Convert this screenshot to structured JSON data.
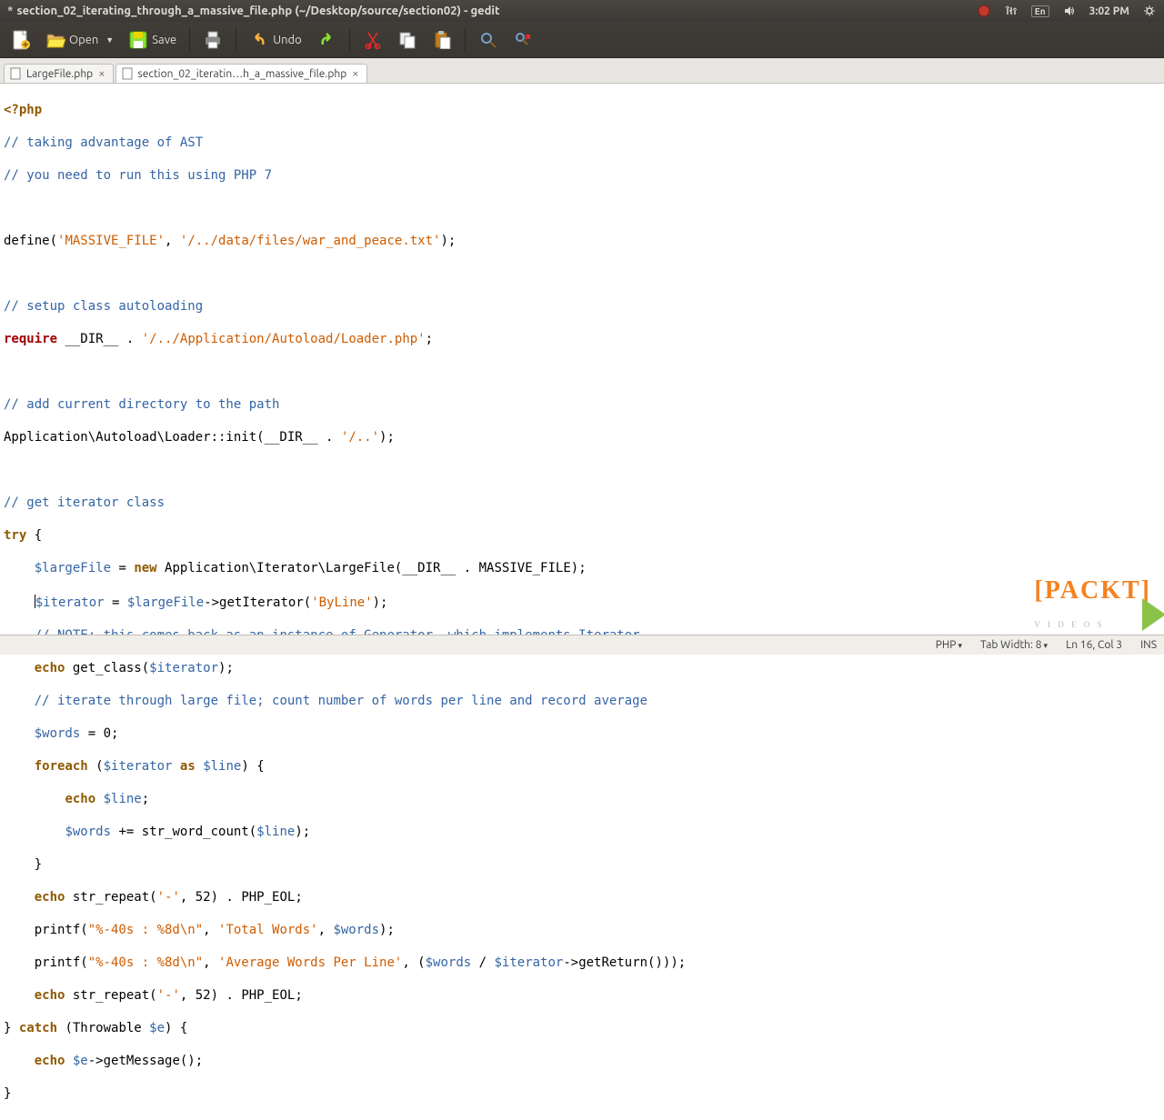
{
  "titlebar": {
    "prefix": "*",
    "title": "section_02_iterating_through_a_massive_file.php (~/Desktop/source/section02) - gedit",
    "tray": {
      "lang": "En",
      "time": "3:02 PM"
    }
  },
  "toolbar": {
    "open": "Open",
    "save": "Save",
    "undo": "Undo"
  },
  "tabs": [
    {
      "label": "LargeFile.php"
    },
    {
      "label": "section_02_iteratin…h_a_massive_file.php"
    }
  ],
  "code": {
    "l01_open": "<?php",
    "l02": "// taking advantage of AST",
    "l03": "// you need to run this using PHP 7",
    "l05a": "define(",
    "l05b": "'MASSIVE_FILE'",
    "l05c": ", ",
    "l05d": "'/../data/files/war_and_peace.txt'",
    "l05e": ");",
    "l07": "// setup class autoloading",
    "l08a": "require ",
    "l08b": "__DIR__",
    "l08c": " . ",
    "l08d": "'/../Application/Autoload/Loader.php'",
    "l08e": ";",
    "l10": "// add current directory to the path",
    "l11a": "Application\\Autoload\\Loader::init(",
    "l11b": "__DIR__",
    "l11c": " . ",
    "l11d": "'/..'",
    "l11e": ");",
    "l13": "// get iterator class",
    "l14a": "try",
    "l14b": " {",
    "l15a": "    ",
    "l15b": "$largeFile",
    "l15c": " = ",
    "l15d": "new",
    "l15e": " Application\\Iterator\\LargeFile(",
    "l15f": "__DIR__",
    "l15g": " . MASSIVE_FILE);",
    "l16a": "    ",
    "l16b": "$iterator",
    "l16c": " = ",
    "l16d": "$largeFile",
    "l16e": "->getIterator(",
    "l16f": "'ByLine'",
    "l16g": ");",
    "l17a": "    ",
    "l17b": "// NOTE: this comes back as an instance of Generator, which implements Iterator",
    "l18a": "    ",
    "l18b": "echo",
    "l18c": " get_class(",
    "l18d": "$iterator",
    "l18e": ");",
    "l19a": "    ",
    "l19b": "// iterate through large file; count number of words per line and record average",
    "l20a": "    ",
    "l20b": "$words",
    "l20c": " = ",
    "l20d": "0",
    "l20e": ";",
    "l21a": "    ",
    "l21b": "foreach",
    "l21c": " (",
    "l21d": "$iterator",
    "l21e": " ",
    "l21f": "as",
    "l21g": " ",
    "l21h": "$line",
    "l21i": ") {",
    "l22a": "        ",
    "l22b": "echo",
    "l22c": " ",
    "l22d": "$line",
    "l22e": ";",
    "l23a": "        ",
    "l23b": "$words",
    "l23c": " += str_word_count(",
    "l23d": "$line",
    "l23e": ");",
    "l24": "    }",
    "l25a": "    ",
    "l25b": "echo",
    "l25c": " str_repeat(",
    "l25d": "'-'",
    "l25e": ", ",
    "l25f": "52",
    "l25g": ") . PHP_EOL;",
    "l26a": "    printf(",
    "l26b": "\"%-40s : %8d\\n\"",
    "l26c": ", ",
    "l26d": "'Total Words'",
    "l26e": ", ",
    "l26f": "$words",
    "l26g": ");",
    "l27a": "    printf(",
    "l27b": "\"%-40s : %8d\\n\"",
    "l27c": ", ",
    "l27d": "'Average Words Per Line'",
    "l27e": ", (",
    "l27f": "$words",
    "l27g": " / ",
    "l27h": "$iterator",
    "l27i": "->getReturn()));",
    "l28a": "    ",
    "l28b": "echo",
    "l28c": " str_repeat(",
    "l28d": "'-'",
    "l28e": ", ",
    "l28f": "52",
    "l28g": ") . PHP_EOL;",
    "l29a": "} ",
    "l29b": "catch",
    "l29c": " (Throwable ",
    "l29d": "$e",
    "l29e": ") {",
    "l30a": "    ",
    "l30b": "echo",
    "l30c": " ",
    "l30d": "$e",
    "l30e": "->getMessage();",
    "l31": "}"
  },
  "status": {
    "lang": "PHP",
    "tabwidth": "Tab Width: 8",
    "pos": "Ln 16, Col 3",
    "ins": "INS"
  },
  "brand": {
    "name": "PACKT",
    "sub": "V I D E O S"
  }
}
